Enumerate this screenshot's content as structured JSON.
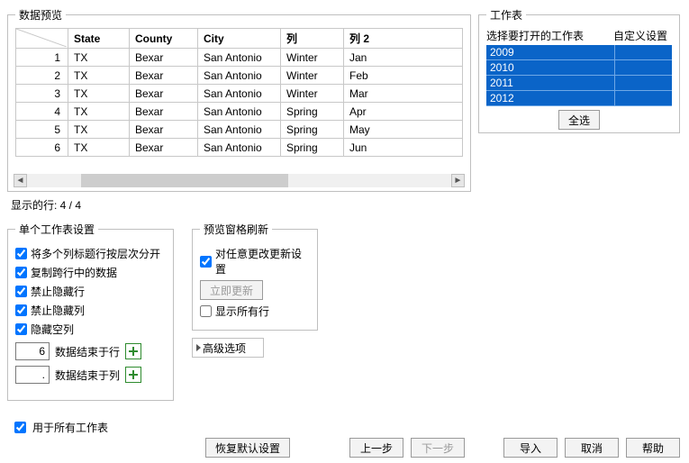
{
  "preview": {
    "legend": "数据预览",
    "columns": [
      "",
      "State",
      "County",
      "City",
      "列",
      "列 2"
    ],
    "rows": [
      {
        "n": "1",
        "cells": [
          "TX",
          "Bexar",
          "San Antonio",
          "Winter",
          "Jan"
        ]
      },
      {
        "n": "2",
        "cells": [
          "TX",
          "Bexar",
          "San Antonio",
          "Winter",
          "Feb"
        ]
      },
      {
        "n": "3",
        "cells": [
          "TX",
          "Bexar",
          "San Antonio",
          "Winter",
          "Mar"
        ]
      },
      {
        "n": "4",
        "cells": [
          "TX",
          "Bexar",
          "San Antonio",
          "Spring",
          "Apr"
        ]
      },
      {
        "n": "5",
        "cells": [
          "TX",
          "Bexar",
          "San Antonio",
          "Spring",
          "May"
        ]
      },
      {
        "n": "6",
        "cells": [
          "TX",
          "Bexar",
          "San Antonio",
          "Spring",
          "Jun"
        ]
      }
    ]
  },
  "rows_shown": "显示的行: 4 / 4",
  "worksheets": {
    "legend": "工作表",
    "header_col1": "选择要打开的工作表",
    "header_col2": "自定义设置",
    "items": [
      "2009",
      "2010",
      "2011",
      "2012"
    ],
    "select_all": "全选"
  },
  "single_sheet": {
    "legend": "单个工作表设置",
    "opt_multilabel": "将多个列标题行按层次分开",
    "opt_copy_span": "复制跨行中的数据",
    "opt_forbid_hide_row": "禁止隐藏行",
    "opt_forbid_hide_col": "禁止隐藏列",
    "opt_hide_empty_col": "隐藏空列",
    "end_row_value": "6",
    "end_row_label": "数据结束于行",
    "end_col_value": ".",
    "end_col_label": "数据结束于列"
  },
  "refresh": {
    "legend": "预览窗格刷新",
    "opt_any_change": "对任意更改更新设置",
    "update_now": "立即更新",
    "show_all_rows": "显示所有行"
  },
  "advanced": "高级选项",
  "apply_all": "用于所有工作表",
  "buttons": {
    "restore": "恢复默认设置",
    "prev": "上一步",
    "next": "下一步",
    "import": "导入",
    "cancel": "取消",
    "help": "帮助"
  }
}
